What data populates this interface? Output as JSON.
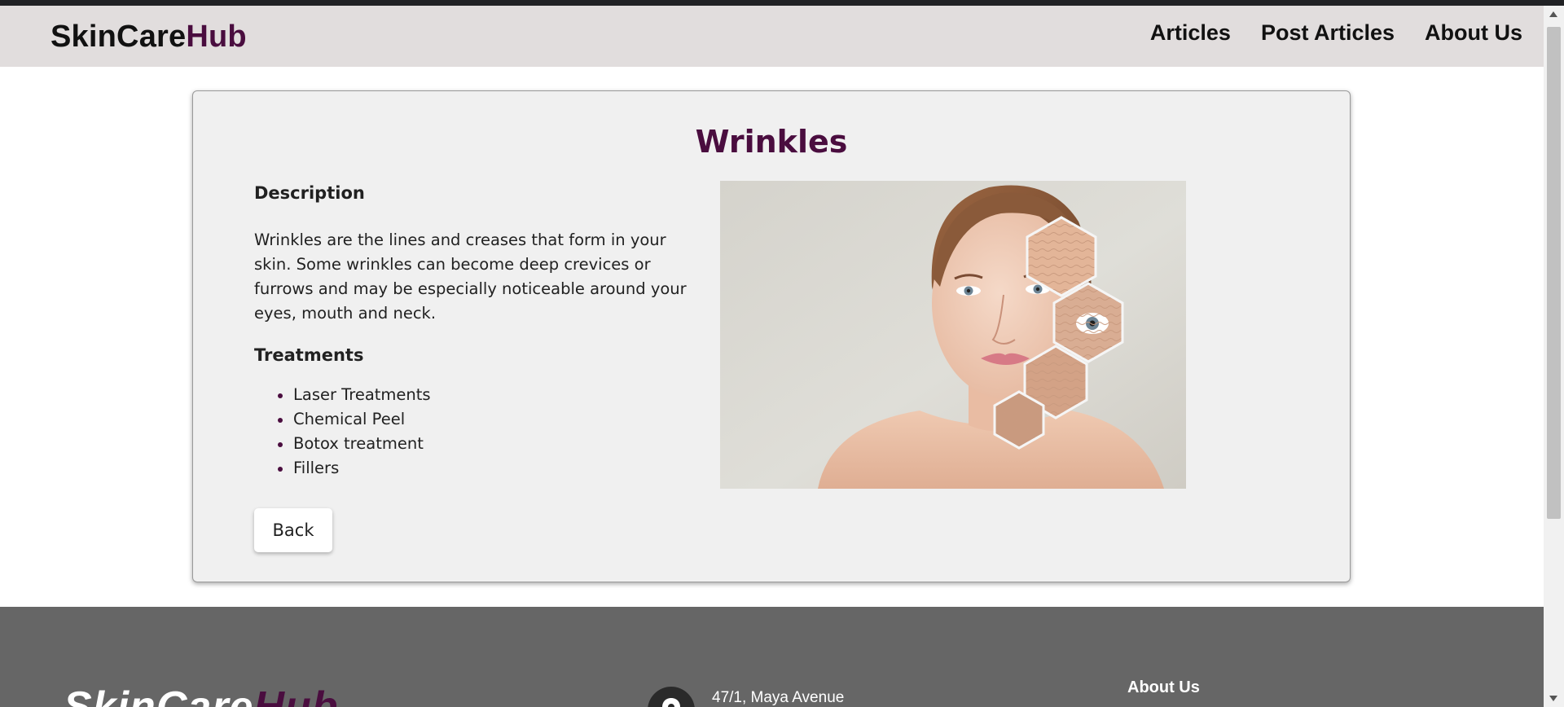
{
  "header": {
    "brand_part1": "SkinCare",
    "brand_part2": "Hub",
    "nav": [
      {
        "label": "Articles"
      },
      {
        "label": "Post Articles"
      },
      {
        "label": "About Us"
      }
    ]
  },
  "article": {
    "title": "Wrinkles",
    "description_heading": "Description",
    "description_text": "Wrinkles are the lines and creases that form in your skin. Some wrinkles can become deep crevices or furrows and may be especially noticeable around your eyes, mouth and neck.",
    "treatments_heading": "Treatments",
    "treatments": [
      "Laser Treatments",
      "Chemical Peel",
      "Botox treatment",
      "Fillers"
    ],
    "back_label": "Back"
  },
  "footer": {
    "brand_part1": "SkinCare",
    "brand_part2": "Hub",
    "address_line1": "47/1, Maya Avenue",
    "about_heading": "About Us"
  },
  "colors": {
    "accent": "#4a0d3f",
    "header_bg": "#e1dddd",
    "card_bg": "#f0f0f0",
    "footer_bg": "#666666"
  },
  "icons": {
    "footer_location": "location-pin-icon"
  }
}
